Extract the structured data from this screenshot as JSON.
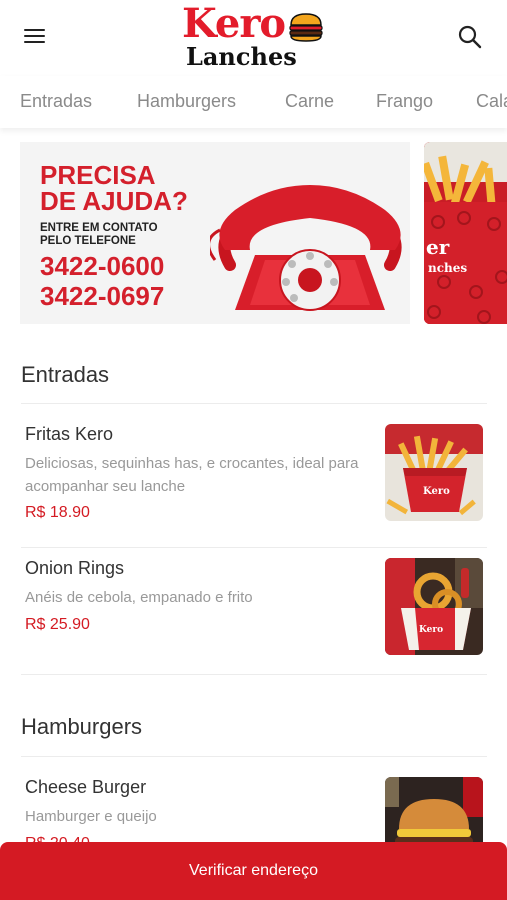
{
  "header": {
    "logo_top": "Kero",
    "logo_bottom": "Lanches",
    "menu_icon": "hamburger-menu-icon",
    "search_icon": "search-icon"
  },
  "tabs": [
    "Entradas",
    "Hamburgers",
    "Carne",
    "Frango",
    "Cala"
  ],
  "banner": {
    "title_line1": "PRECISA",
    "title_line2": "DE AJUDA?",
    "subtitle_line1": "ENTRE EM CONTATO",
    "subtitle_line2": "PELO TELEFONE",
    "phone1": "3422-0600",
    "phone2": "3422-0697"
  },
  "sections": [
    {
      "title": "Entradas",
      "items": [
        {
          "name": "Fritas Kero",
          "description": "Deliciosas, sequinhas has, e crocantes, ideal para acompanhar seu lanche",
          "price": "R$ 18.90"
        },
        {
          "name": "Onion Rings",
          "description": "Anéis de cebola, empanado e frito",
          "price": "R$ 25.90"
        }
      ]
    },
    {
      "title": "Hamburgers",
      "items": [
        {
          "name": "Cheese Burger",
          "description": "Hamburger e queijo",
          "price": "R$ 20.40"
        }
      ]
    }
  ],
  "bottom_button": "Verificar endereço",
  "colors": {
    "accent": "#d41a23",
    "text": "#333333",
    "muted": "#999999"
  }
}
